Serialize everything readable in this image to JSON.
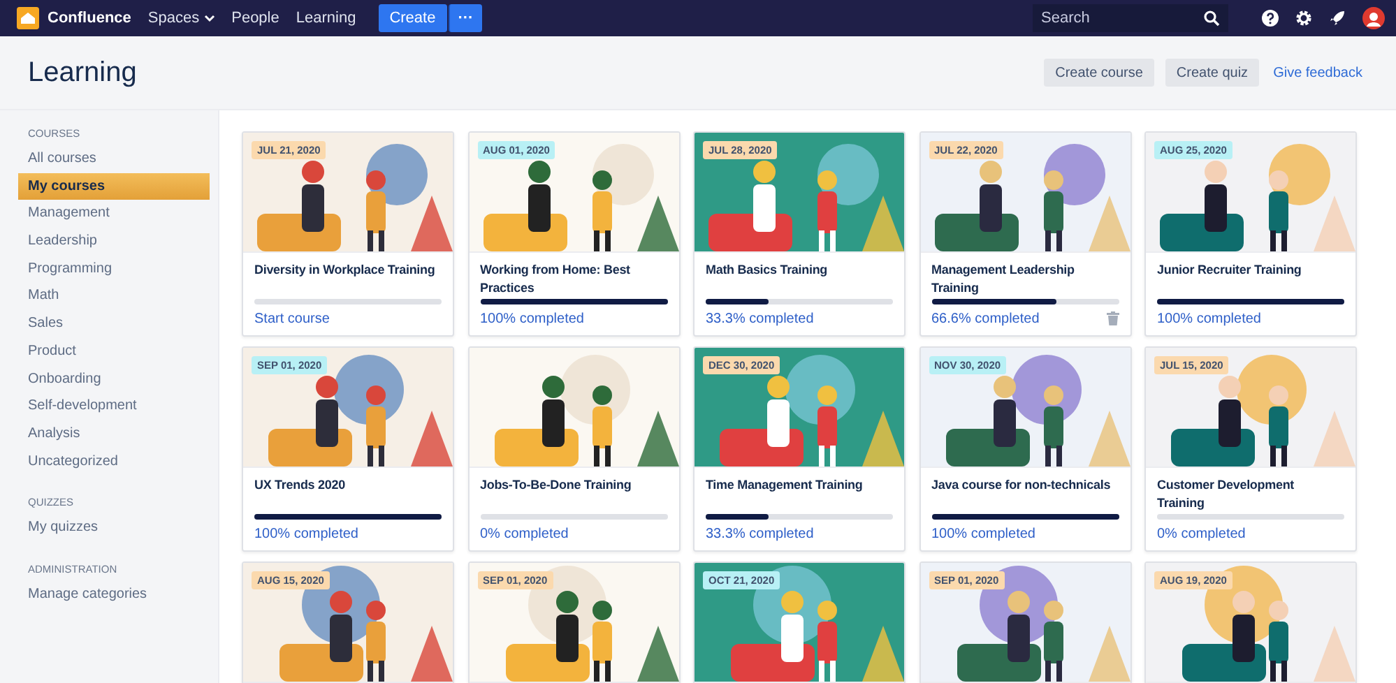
{
  "nav": {
    "product": "Confluence",
    "items": [
      {
        "label": "Spaces",
        "dropdown": true
      },
      {
        "label": "People",
        "dropdown": false
      },
      {
        "label": "Learning",
        "dropdown": false
      }
    ],
    "create": "Create",
    "more": "···",
    "search": {
      "placeholder": "Search"
    }
  },
  "header": {
    "title": "Learning",
    "buttons": [
      "Create course",
      "Create quiz"
    ],
    "link": "Give feedback"
  },
  "sidebar": {
    "sections": [
      {
        "heading": "COURSES",
        "items": [
          {
            "label": "All courses",
            "selected": false
          },
          {
            "label": "My courses",
            "selected": true
          },
          {
            "label": "Management",
            "selected": false
          },
          {
            "label": "Leadership",
            "selected": false
          },
          {
            "label": "Programming",
            "selected": false
          },
          {
            "label": "Math",
            "selected": false
          },
          {
            "label": "Sales",
            "selected": false
          },
          {
            "label": "Product",
            "selected": false
          },
          {
            "label": "Onboarding",
            "selected": false
          },
          {
            "label": "Self-development",
            "selected": false
          },
          {
            "label": "Analysis",
            "selected": false
          },
          {
            "label": "Uncategorized",
            "selected": false
          }
        ]
      },
      {
        "heading": "QUIZZES",
        "items": [
          {
            "label": "My quizzes",
            "selected": false
          }
        ]
      },
      {
        "heading": "ADMINISTRATION",
        "items": [
          {
            "label": "Manage categories",
            "selected": false
          }
        ]
      }
    ]
  },
  "courses": [
    {
      "date": "JUL 21, 2020",
      "color": "#fbd9ad",
      "title": "Diversity in Workplace Training",
      "level": 0,
      "status": "Start course",
      "hovered": false
    },
    {
      "date": "AUG 01, 2020",
      "color": "#b8f0f5",
      "title": "Working from Home: Best Practices",
      "level": 1,
      "status": "100% completed",
      "hovered": false
    },
    {
      "date": "JUL 28, 2020",
      "color": "#fbd9ad",
      "title": "Math Basics Training",
      "level": 0.333,
      "status": "33.3% completed",
      "hovered": false
    },
    {
      "date": "JUL 22, 2020",
      "color": "#fbd9ad",
      "title": "Management Leadership Training",
      "level": 0.666,
      "status": "66.6% completed",
      "hovered": true
    },
    {
      "date": "AUG 25, 2020",
      "color": "#b8f0f5",
      "title": "Junior Recruiter Training",
      "level": 1,
      "status": "100% completed",
      "hovered": false
    },
    {
      "date": "SEP 01, 2020",
      "color": "#b8f0f5",
      "title": "UX Trends 2020",
      "level": 1,
      "status": "100% completed",
      "hovered": false
    },
    {
      "title": "Jobs-To-Be-Done Training",
      "level": 0,
      "status": "0% completed",
      "hovered": false
    },
    {
      "date": "DEC 30, 2020",
      "color": "#fbd9ad",
      "title": "Time Management Training",
      "level": 0.333,
      "status": "33.3% completed",
      "hovered": false
    },
    {
      "date": "NOV 30, 2020",
      "color": "#b8f0f5",
      "title": "Java course for non-technicals",
      "level": 1,
      "status": "100% completed",
      "hovered": false
    },
    {
      "date": "JUL 15, 2020",
      "color": "#fbd9ad",
      "title": "Customer Development Training",
      "level": 0,
      "status": "0% completed",
      "hovered": false
    },
    {
      "date": "AUG 15, 2020",
      "color": "#fbd9ad"
    },
    {
      "date": "SEP 01, 2020",
      "color": "#fbd9ad"
    },
    {
      "date": "OCT 21, 2020",
      "color": "#b8f0f5"
    },
    {
      "date": "SEP 01, 2020",
      "color": "#fbd9ad"
    },
    {
      "date": "AUG 19, 2020",
      "color": "#fbd9ad"
    }
  ]
}
